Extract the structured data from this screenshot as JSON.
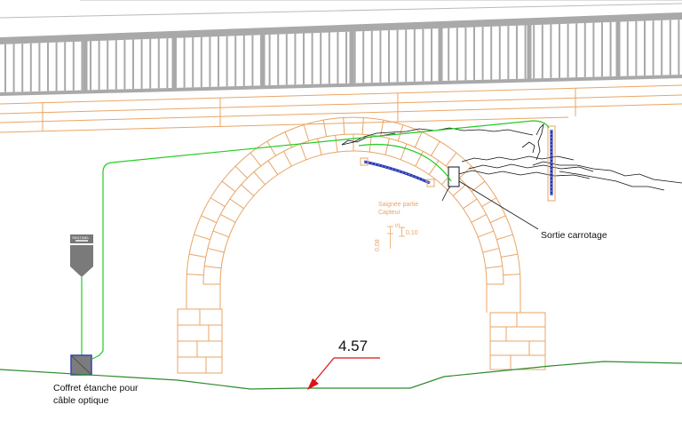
{
  "labels": {
    "coffret_line1": "Coffret étanche pour",
    "coffret_line2": "câble optique",
    "sortie": "Sortie carrotage",
    "dimension": "4.57",
    "sensor_label_1": "Saignée partie",
    "sensor_label_2": "Capteur",
    "dim_small_1": "0,08",
    "dim_small_2": "S",
    "dim_small_3": "0,10",
    "box_tag": "SENTINEL"
  },
  "colors": {
    "railing": "#a9a9a9",
    "masonry": "#e8a565",
    "cable": "#22cc22",
    "sensor": "#2233aa",
    "ground": "#2e8b2e",
    "pointer": "#dd1111",
    "rock": "#111111"
  }
}
